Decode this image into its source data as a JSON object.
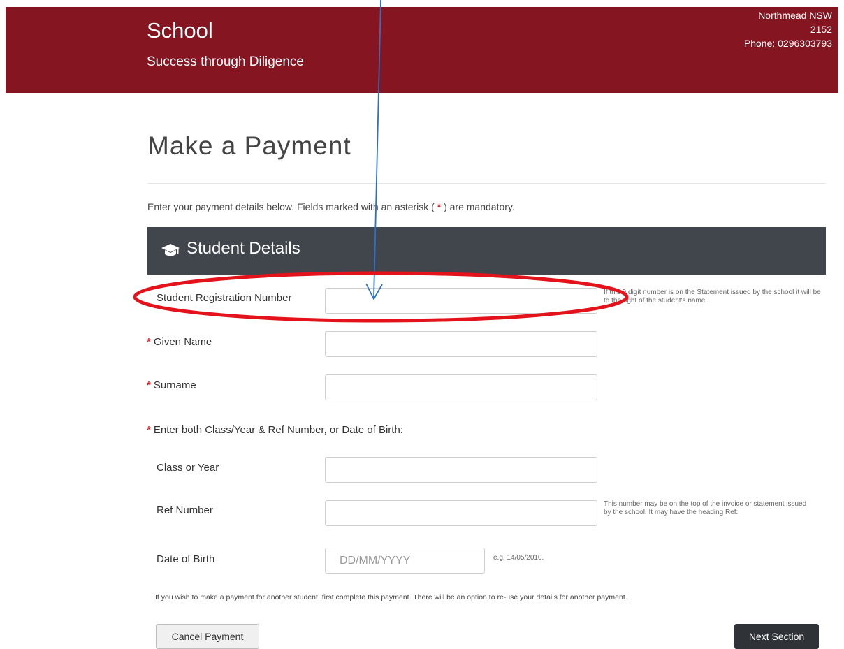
{
  "header": {
    "school_name": "School",
    "tagline": "Success through Diligence",
    "address_line1": "Northmead NSW",
    "address_line2": "2152",
    "phone": "Phone: 0296303793",
    "bg_color": "#851520"
  },
  "page": {
    "title": "Make a Payment",
    "intro_before": "Enter your payment details below. Fields marked with an asterisk (",
    "intro_asterisk": "*",
    "intro_after": ") are mandatory."
  },
  "section": {
    "icon": "graduation-cap-icon",
    "title": "Student Details",
    "bg_color": "#41454c"
  },
  "fields": {
    "srn_label": "Student Registration Number",
    "srn_value": "",
    "srn_hint": "If this 9 digit number is on the Statement issued by the school it will be to the right of the student's name",
    "given_name_label": "Given Name",
    "given_name_value": "",
    "surname_label": "Surname",
    "surname_value": "",
    "either_label": "Enter both Class/Year & Ref Number, or Date of Birth:",
    "class_label": "Class or Year",
    "class_value": "",
    "ref_label": "Ref Number",
    "ref_value": "",
    "ref_hint": "This number may be on the top of the invoice or statement issued by the school. It may have the heading Ref:",
    "dob_label": "Date of Birth",
    "dob_placeholder": "DD/MM/YYYY",
    "dob_hint": "e.g. 14/05/2010.",
    "required_marker": "*"
  },
  "note": "If you wish to make a payment for another student, first complete this payment. There will be an option to re-use your details for another payment.",
  "buttons": {
    "cancel": "Cancel Payment",
    "next": "Next Section"
  },
  "annotation": {
    "arrow_color": "#2f6fc4",
    "ellipse_color": "#e3121b"
  }
}
